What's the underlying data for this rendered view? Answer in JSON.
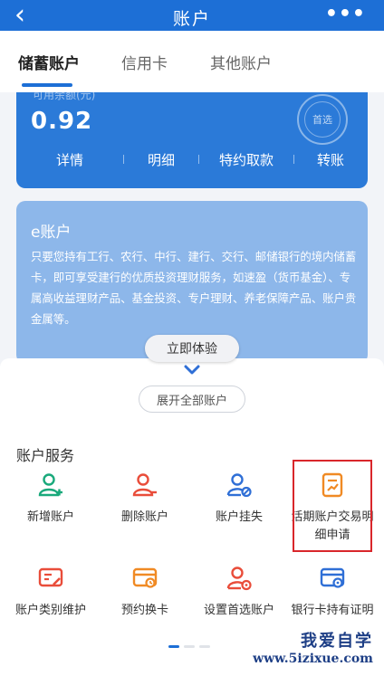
{
  "header": {
    "title": "账户",
    "back_icon": "chevron-left-icon",
    "more_icon": "more-dots-icon",
    "color": "#1d6fd6"
  },
  "tabs": [
    {
      "label": "储蓄账户",
      "active": true
    },
    {
      "label": "信用卡",
      "active": false
    },
    {
      "label": "其他账户",
      "active": false
    }
  ],
  "account_card": {
    "top_label": "可用余额(元)",
    "balance": "0.92",
    "stamp_text": "首选",
    "actions": [
      "详情",
      "明细",
      "特约取款",
      "转账"
    ]
  },
  "e_account": {
    "title": "e账户",
    "description": "只要您持有工行、农行、中行、建行、交行、邮储银行的境内储蓄卡，即可享受建行的优质投资理财服务，如速盈（货币基金）、专属高收益理财产品、基金投资、专户理财、养老保障产品、账户贵金属等。",
    "button": "立即体验"
  },
  "expand_button": "展开全部账户",
  "services": {
    "title": "账户服务",
    "items": [
      {
        "label": "新增账户",
        "icon": "add-user-icon",
        "color": "#19a97b"
      },
      {
        "label": "删除账户",
        "icon": "remove-user-icon",
        "color": "#e94d3a"
      },
      {
        "label": "账户挂失",
        "icon": "user-block-icon",
        "color": "#2f6fd6"
      },
      {
        "label": "活期账户交易明细申请",
        "icon": "document-chart-icon",
        "color": "#f08a24",
        "highlighted": true
      },
      {
        "label": "账户类别维护",
        "icon": "card-edit-icon",
        "color": "#e94d3a"
      },
      {
        "label": "预约换卡",
        "icon": "card-clock-icon",
        "color": "#f08a24"
      },
      {
        "label": "设置首选账户",
        "icon": "user-settings-icon",
        "color": "#e94d3a"
      },
      {
        "label": "银行卡持有证明",
        "icon": "card-check-icon",
        "color": "#2f6fd6"
      }
    ]
  },
  "pager": {
    "pages": 3,
    "current": 1
  },
  "watermark": {
    "line1": "我爱自学",
    "line2": "www.5izixue.com"
  }
}
